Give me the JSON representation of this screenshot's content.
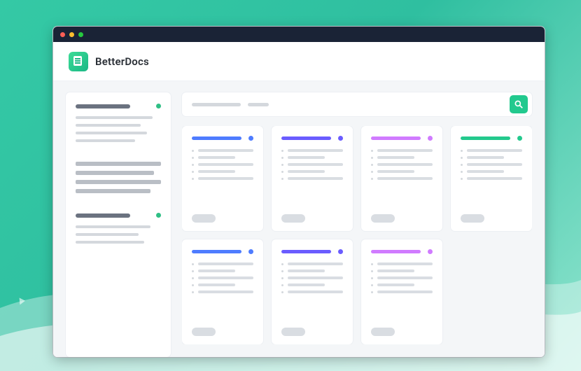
{
  "brand": {
    "name": "BetterDocs"
  },
  "sidebar": {
    "groups": [
      {
        "title_w": 78,
        "lines": [
          90,
          76,
          84,
          70
        ],
        "bold": false
      },
      {
        "title_w": 0,
        "lines": [
          100,
          92,
          100,
          88
        ],
        "bold": true,
        "no_head": true
      },
      {
        "title_w": 78,
        "lines": [
          88,
          74,
          80
        ],
        "bold": false
      }
    ]
  },
  "search": {
    "placeholder_widths": [
      70,
      30
    ]
  },
  "cards": [
    {
      "accent": "#4e7cff",
      "title_w": 70
    },
    {
      "accent": "#6a5cff",
      "title_w": 68
    },
    {
      "accent": "#d07bff",
      "title_w": 66
    },
    {
      "accent": "#23c98d",
      "title_w": 72
    },
    {
      "accent": "#4e7cff",
      "title_w": 70
    },
    {
      "accent": "#6a5cff",
      "title_w": 68
    },
    {
      "accent": "#d07bff",
      "title_w": 66
    }
  ],
  "card_line_widths": [
    100,
    92,
    100,
    86,
    94
  ]
}
